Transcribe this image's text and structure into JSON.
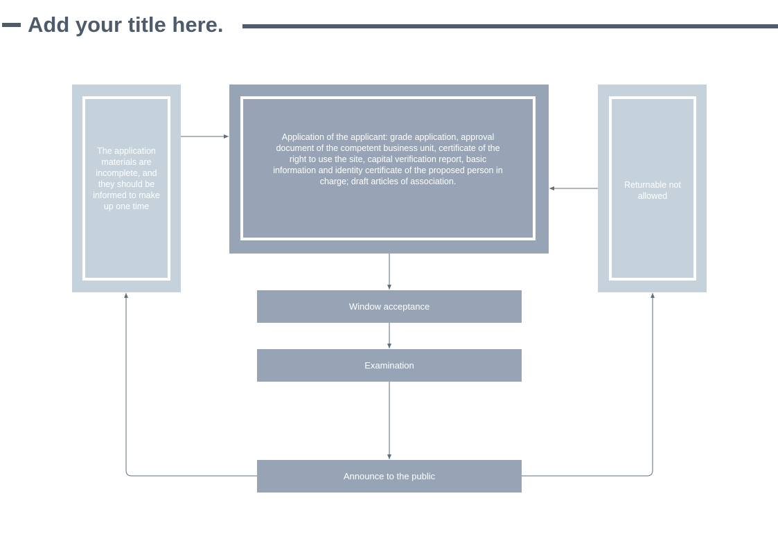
{
  "page": {
    "title": "Add your title here."
  },
  "diagram": {
    "nodes": {
      "application": "Application of the applicant: grade application, approval document of the competent business unit, certificate of the right to use the site, capital verification report, basic information and identity certificate of the proposed person in charge; draft articles of association.",
      "incomplete": "The application materials are incomplete, and they should be informed to make up one time",
      "returnable": "Returnable not allowed",
      "window_acceptance": "Window acceptance",
      "examination": "Examination",
      "announce": "Announce to the public"
    },
    "edges": [
      {
        "from": "incomplete",
        "to": "application"
      },
      {
        "from": "returnable",
        "to": "application"
      },
      {
        "from": "application",
        "to": "window_acceptance"
      },
      {
        "from": "window_acceptance",
        "to": "examination"
      },
      {
        "from": "examination",
        "to": "announce"
      },
      {
        "from": "announce",
        "to": "incomplete"
      },
      {
        "from": "announce",
        "to": "returnable"
      }
    ],
    "colors": {
      "title": "#4e5b6b",
      "main_fill": "#96a4b6",
      "side_fill": "#c5d2db",
      "connector": "#5f6f7d"
    }
  }
}
